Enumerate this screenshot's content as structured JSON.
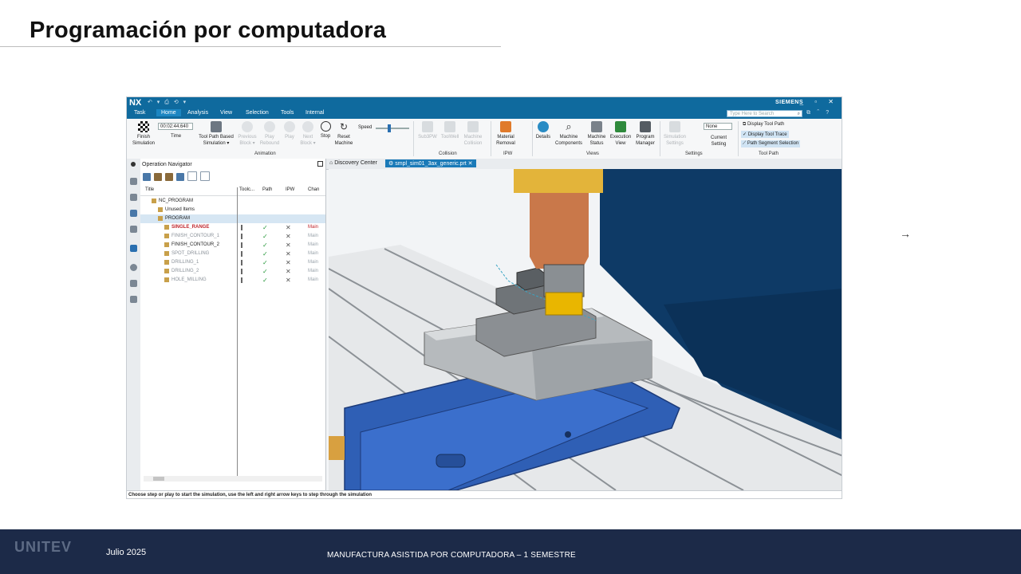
{
  "slide": {
    "title": "Programación por computadora",
    "footer_logo": "UNITEV",
    "footer_date": "Julio 2025",
    "footer_course": "MANUFACTURA ASISTIDA POR COMPUTADORA  – 1     SEMESTRE"
  },
  "nx": {
    "app_logo": "NX",
    "brand": "SIEMENS",
    "menu": [
      "Task",
      "Home",
      "Analysis",
      "View",
      "Selection",
      "Tools",
      "Internal"
    ],
    "active_menu": "Home",
    "search_placeholder": "Type Here to Search",
    "ribbon": {
      "finish_simulation": "Finish Simulation",
      "time_value": "00:02:44.640",
      "time_label": "Time",
      "tool_path_based": "Tool Path Based Simulation ▾",
      "previous_block": "Previous Block ▾",
      "play_rebound": "Play Rebound",
      "play": "Play",
      "next_block": "Next Block ▾",
      "stop": "Stop",
      "reset_machine": "Reset Machine",
      "speed_label": "Speed",
      "speed_fraction": 0.35,
      "collision_items": [
        "Sub3PW",
        "ToolWell",
        "Machine Collision"
      ],
      "material_removal": "Material Removal",
      "details": "Details",
      "machine_components": "Machine Components",
      "machine_status": "Machine Status",
      "execution_view": "Execution View",
      "program_manager": "Program Manager",
      "simulation_settings": "Simulation Settings",
      "none_value": "None",
      "current_setting": "Current Setting",
      "tool_path_items": [
        "Display Tool Path",
        "Display Tool Trace",
        "Path Segment Selection"
      ],
      "groups": [
        "Animation",
        "Collision",
        "IPW",
        "Views",
        "Settings",
        "Tool Path"
      ]
    },
    "operation_navigator": {
      "title": "Operation Navigator",
      "columns": [
        "Title",
        "Toolc...",
        "Path",
        "IPW",
        "Chan"
      ],
      "rows": [
        {
          "name": "NC_PROGRAM",
          "style": "normal",
          "indent": 0,
          "check": "",
          "x": "",
          "main": ""
        },
        {
          "name": "Unused Items",
          "style": "normal",
          "indent": 1,
          "check": "",
          "x": "",
          "main": ""
        },
        {
          "name": "PROGRAM",
          "style": "normal",
          "indent": 1,
          "check": "",
          "x": "",
          "main": ""
        },
        {
          "name": "SINGLE_RANGE",
          "style": "red",
          "indent": 2,
          "check": "✓",
          "x": "✕",
          "main": "Main"
        },
        {
          "name": "FINISH_CONTOUR_1",
          "style": "gray",
          "indent": 2,
          "check": "✓",
          "x": "✕",
          "main": "Main"
        },
        {
          "name": "FINISH_CONTOUR_2",
          "style": "normal",
          "indent": 2,
          "check": "✓",
          "x": "✕",
          "main": "Main"
        },
        {
          "name": "SPOT_DRILLING",
          "style": "gray",
          "indent": 2,
          "check": "✓",
          "x": "✕",
          "main": "Main"
        },
        {
          "name": "DRILLING_1",
          "style": "gray",
          "indent": 2,
          "check": "✓",
          "x": "✕",
          "main": "Main"
        },
        {
          "name": "DRILLING_2",
          "style": "gray",
          "indent": 2,
          "check": "✓",
          "x": "✕",
          "main": "Main"
        },
        {
          "name": "HOLE_MILLING",
          "style": "gray",
          "indent": 2,
          "check": "✓",
          "x": "✕",
          "main": "Main"
        }
      ]
    },
    "doc_tabs": [
      "Discovery Center",
      "smpl_sim01_3ax_generic.prt"
    ],
    "active_doc_tab": "smpl_sim01_3ax_generic.prt",
    "status_text": "Choose step or play to start the simulation, use the left and right arrow keys to step through the simulation"
  }
}
